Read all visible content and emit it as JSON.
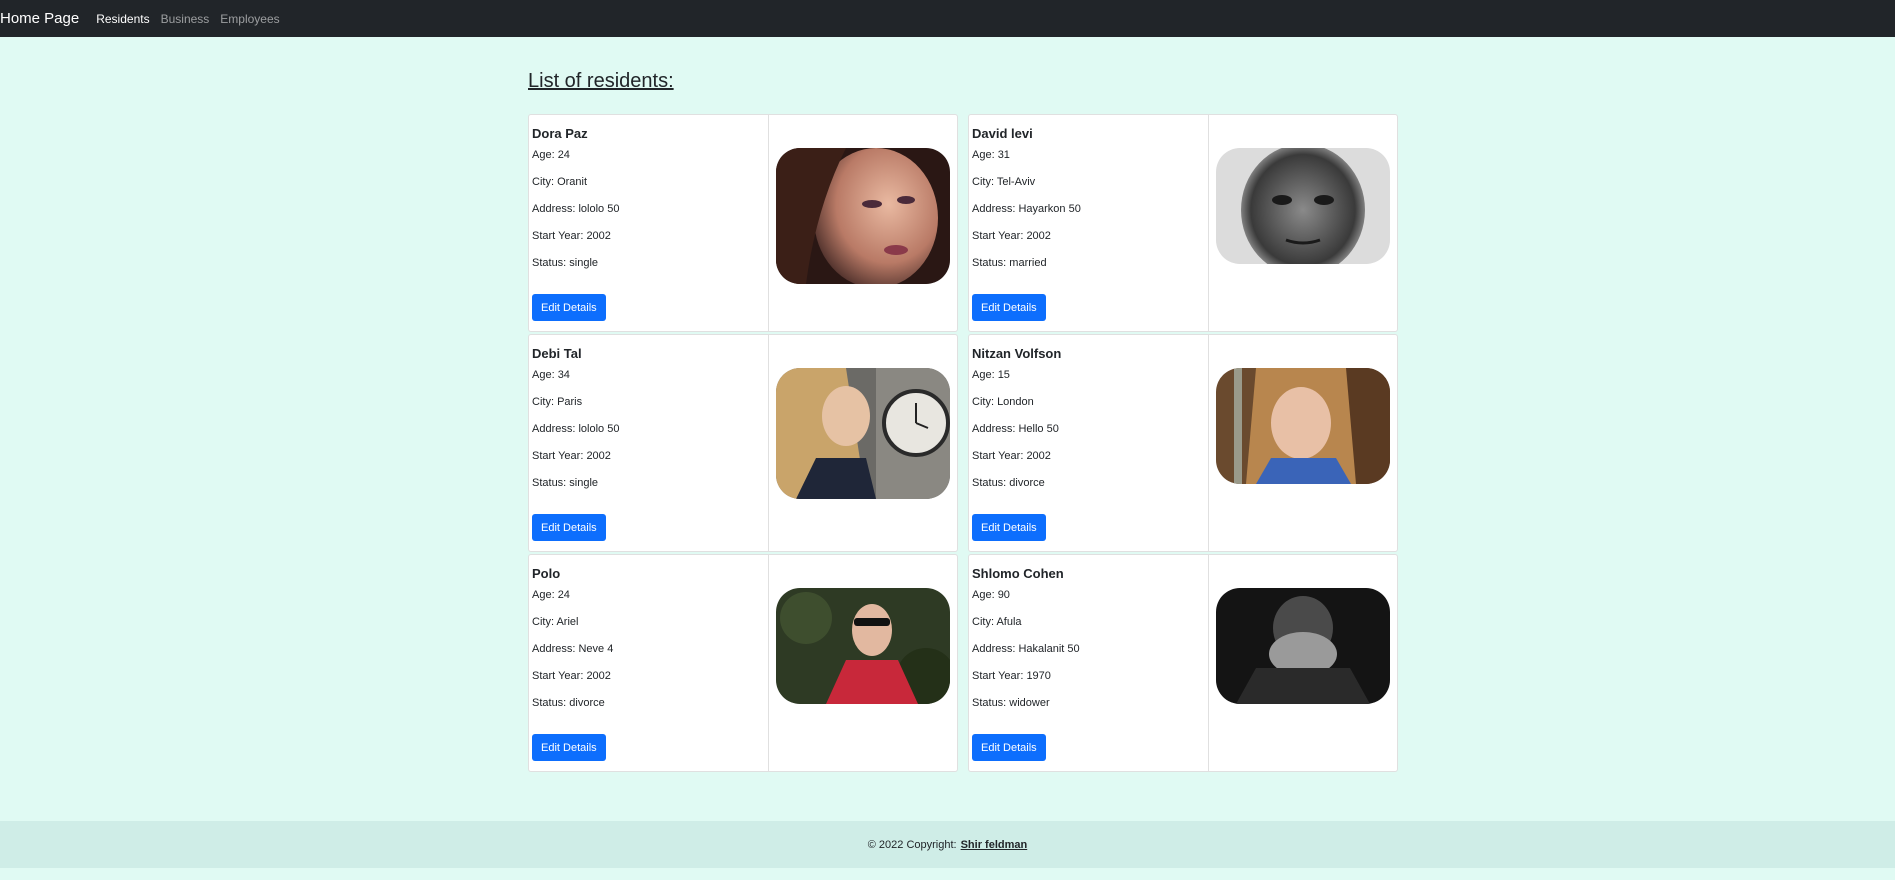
{
  "nav": {
    "brand": "Home Page",
    "links": [
      "Residents",
      "Business",
      "Employees"
    ]
  },
  "page": {
    "title": "List of residents:"
  },
  "labels": {
    "age": "Age: ",
    "city": "City: ",
    "address": "Address: ",
    "start_year": "Start Year: ",
    "status": "Status: ",
    "edit_button": "Edit Details"
  },
  "residents": [
    {
      "name": "Dora Paz",
      "age": "24",
      "city": "Oranit",
      "address": "lololo 50",
      "start_year": "2002",
      "status": "single",
      "photo": "woman-portrait-makeup"
    },
    {
      "name": "David levi",
      "age": "31",
      "city": "Tel-Aviv",
      "address": "Hayarkon 50",
      "start_year": "2002",
      "status": "married",
      "photo": "boy-portrait-bw"
    },
    {
      "name": "Debi Tal",
      "age": "34",
      "city": "Paris",
      "address": "lololo 50",
      "start_year": "2002",
      "status": "single",
      "photo": "woman-with-clock"
    },
    {
      "name": "Nitzan Volfson",
      "age": "15",
      "city": "London",
      "address": "Hello 50",
      "start_year": "2002",
      "status": "divorce",
      "photo": "girl-portrait"
    },
    {
      "name": "Polo",
      "age": "24",
      "city": "Ariel",
      "address": "Neve 4",
      "start_year": "2002",
      "status": "divorce",
      "photo": "man-sunglasses-red-jacket"
    },
    {
      "name": "Shlomo Cohen",
      "age": "90",
      "city": "Afula",
      "address": "Hakalanit 50",
      "start_year": "1970",
      "status": "widower",
      "photo": "old-man-bw"
    }
  ],
  "footer": {
    "copyright": "© 2022 Copyright:",
    "author": "Shir feldman"
  }
}
